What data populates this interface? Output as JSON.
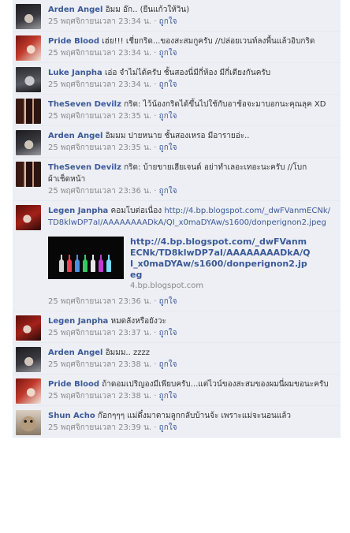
{
  "like_label": "ถูกใจ",
  "comments": [
    {
      "author": "Arden Angel",
      "text": "อิมม อ๊ก.. (ยืนแก้วให้วิน)",
      "time": "25 พฤศจิกายนเวลา 23:34 น.",
      "avatar": "dark-hair-boy-avatar"
    },
    {
      "author": "Pride Blood",
      "text": "เฮ่ย!!! เชี่ยกริด...ของสะสมกูครับ //ปล่อยเวนท์ลงพื้นแล้วอิบกริด",
      "time": "25 พฤศจิกายนเวลา 23:34 น.",
      "avatar": "red-hair-girl-avatar"
    },
    {
      "author": "Luke Janpha",
      "text": "เอ่อ จำไม่ได้ครับ ชั้นสองนี่มีกี่ห้อง มีกี่เตียงกันครับ",
      "time": "25 พฤศจิกายนเวลา 23:34 น.",
      "avatar": "silver-hair-avatar"
    },
    {
      "author": "TheSeven Devilz",
      "text": "กริด: ไว้น้องกริดได้ขึ้นไปใช้กับอาช้อจะมาบอกนะคุณลุค XD",
      "time": "25 พฤศจิกายนเวลา 23:35 น.",
      "avatar": "group-avatar"
    },
    {
      "author": "Arden Angel",
      "text": "อิมมม ปายหนาย ชั้นสองเหรอ มีอารายอ่ะ..",
      "time": "25 พฤศจิกายนเวลา 23:35 น.",
      "avatar": "dark-hair-boy-avatar"
    },
    {
      "author": "TheSeven Devilz",
      "text": "กริด: บ้ายขายเฮียเจนด์ อย่าทำเลอะเทอะนะครับ //โบกผ้าเช็ดหน้า",
      "time": "25 พฤศจิกายนเวลา 23:36 น.",
      "avatar": "group-avatar"
    },
    {
      "author": "Legen Janpha",
      "text": "คอมโบต่อเนื่อง",
      "link_text": "http://4.bp.blogspot.com/_dwFVanmECNk/TD8klwDP7aI/AAAAAAAADkA/QI_x0maDYAw/s1600/donperignon2.jpeg",
      "attachment": {
        "title": "http://4.bp.blogspot.com/_dwFVanmECNk/TD8klwDP7aI/AAAAAAAADkA/QI_x0maDYAw/s1600/donperignon2.jpeg",
        "domain": "4.bp.blogspot.com"
      },
      "time": "25 พฤศจิกายนเวลา 23:36 น.",
      "avatar": "red-hair-boy-avatar"
    },
    {
      "author": "Legen Janpha",
      "text": "หมดลังหรือยังวะ",
      "time": "25 พฤศจิกายนเวลา 23:37 น.",
      "avatar": "red-hair-boy-avatar"
    },
    {
      "author": "Arden Angel",
      "text": "อิมมม.. zzzz",
      "time": "25 พฤศจิกายนเวลา 23:38 น.",
      "avatar": "dark-hair-boy-avatar"
    },
    {
      "author": "Pride Blood",
      "text": "ถ้าดอมเปริญองมีเพียบครับ...แต่ไวน์ของสะสมของผมนี่ผมขอนะครับ",
      "time": "25 พฤศจิกายนเวลา 23:38 น.",
      "avatar": "red-hair-girl-avatar"
    },
    {
      "author": "Shun Acho",
      "text": "ก๊อกๆๆๆ แม่ดึ๋งมาตามลูกกลับบ้านจ้ะ เพราะแม่จะนอนแล้ว",
      "time": "25 พฤศจิกายนเวลา 23:39 น.",
      "avatar": "cat-avatar"
    }
  ]
}
